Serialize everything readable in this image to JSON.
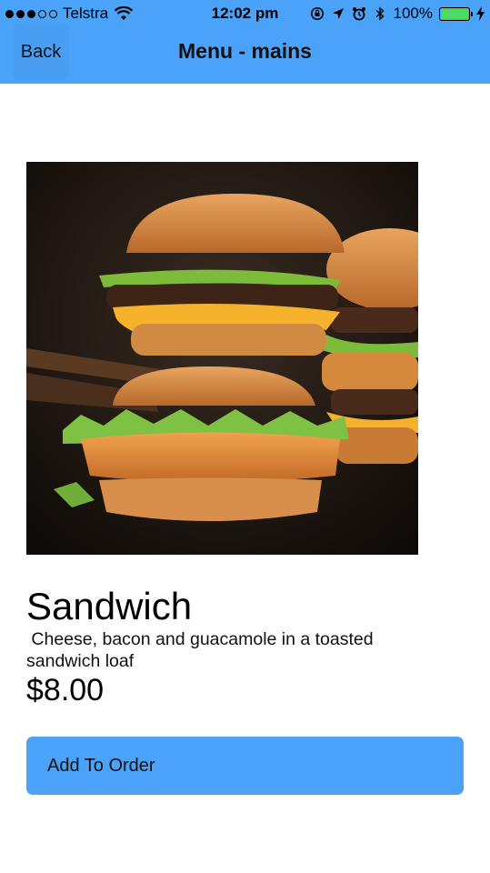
{
  "status_bar": {
    "carrier": "Telstra",
    "signal_dots_filled": 3,
    "signal_dots_total": 5,
    "time": "12:02 pm",
    "battery_percent": "100%",
    "icons": [
      "wifi-icon",
      "orientation-lock-icon",
      "location-arrow-icon",
      "alarm-icon",
      "bluetooth-icon",
      "battery-icon",
      "charging-bolt-icon"
    ]
  },
  "nav": {
    "back_label": "Back",
    "title": "Menu - mains"
  },
  "item": {
    "image_alt": "burger-photo",
    "name": "Sandwich",
    "description": " Cheese, bacon and guacamole in a toasted sandwich loaf",
    "price": "$8.00",
    "add_button_label": "Add To Order"
  },
  "colors": {
    "accent": "#4aa3f8",
    "back_button": "#479ef3",
    "battery_fill": "#4cd964"
  }
}
